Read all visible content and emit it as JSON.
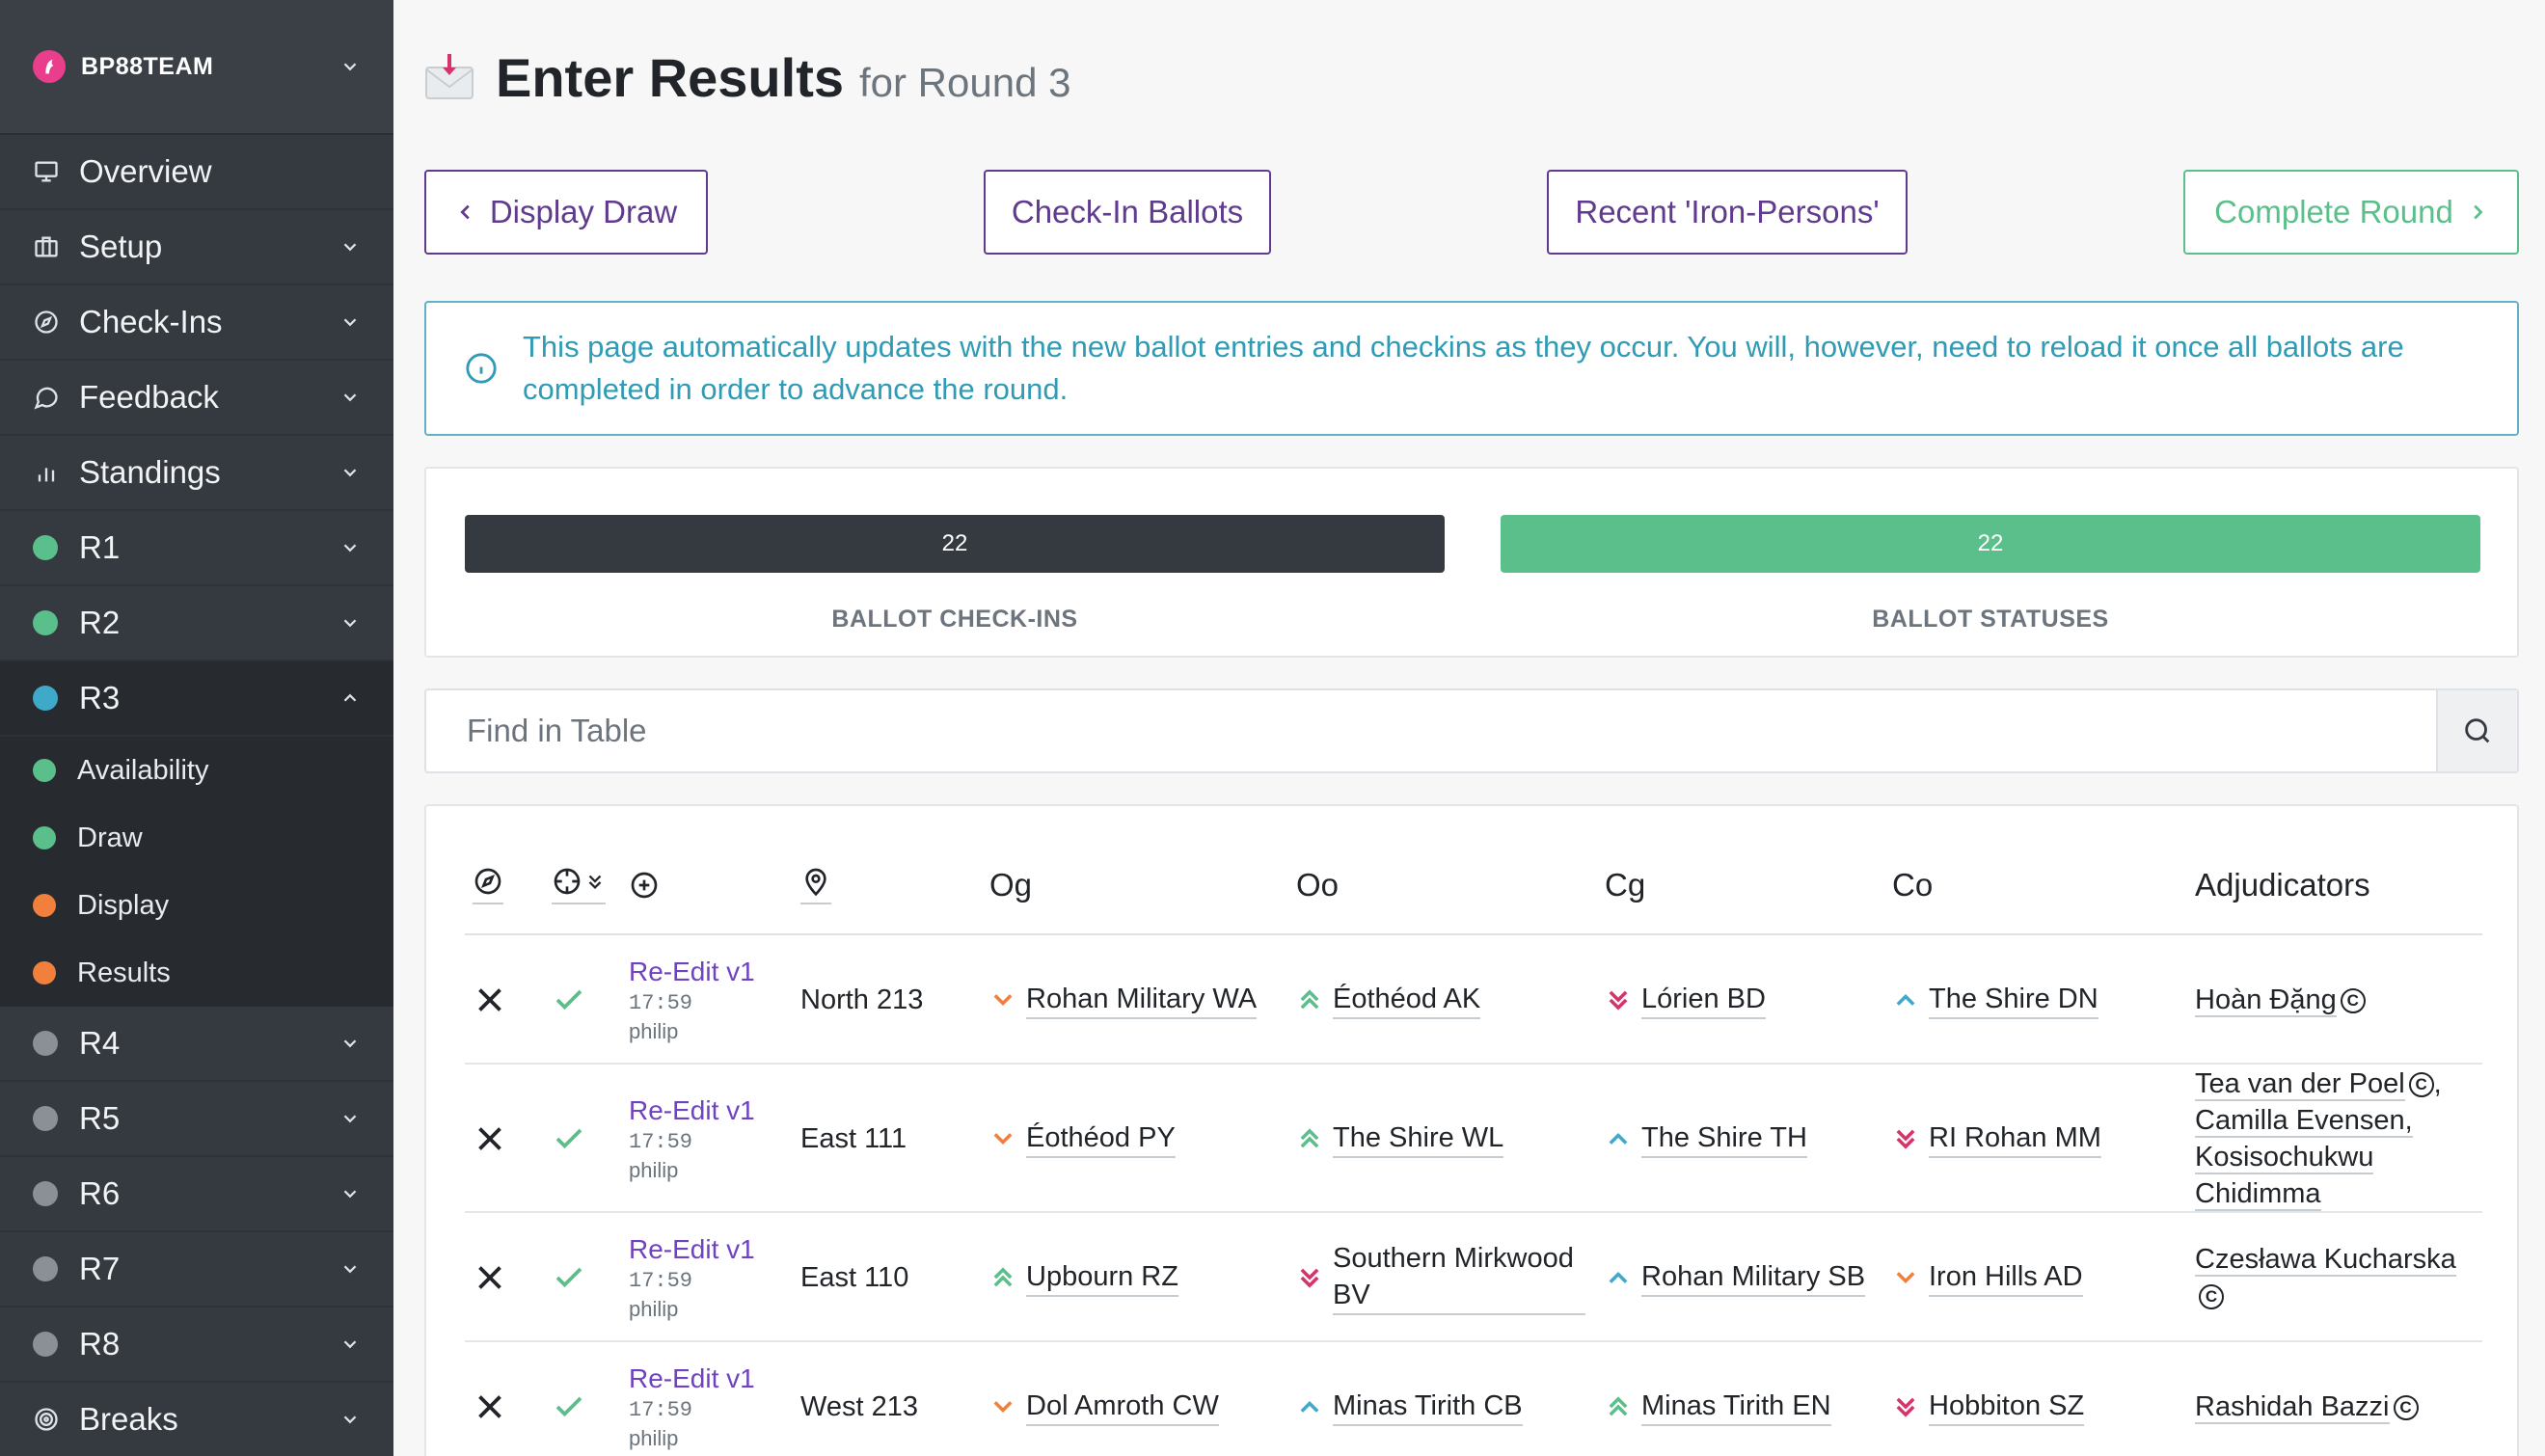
{
  "sidebar": {
    "team": "BP88TEAM",
    "items": [
      {
        "label": "Overview"
      },
      {
        "label": "Setup"
      },
      {
        "label": "Check-Ins"
      },
      {
        "label": "Feedback"
      },
      {
        "label": "Standings"
      },
      {
        "label": "R1"
      },
      {
        "label": "R2"
      },
      {
        "label": "R3"
      },
      {
        "label": "R4"
      },
      {
        "label": "R5"
      },
      {
        "label": "R6"
      },
      {
        "label": "R7"
      },
      {
        "label": "R8"
      },
      {
        "label": "Breaks"
      }
    ],
    "r3_sub": [
      {
        "label": "Availability"
      },
      {
        "label": "Draw"
      },
      {
        "label": "Display"
      },
      {
        "label": "Results"
      }
    ]
  },
  "header": {
    "title": "Enter Results",
    "subtitle": "for Round 3"
  },
  "actions": {
    "display_draw": "Display Draw",
    "check_in_ballots": "Check-In Ballots",
    "recent_iron": "Recent 'Iron-Persons'",
    "complete_round": "Complete Round"
  },
  "alert": {
    "text": "This page automatically updates with the new ballot entries and checkins as they occur. You will, however, need to reload it once all ballots are completed in order to advance the round."
  },
  "stats": {
    "checkins": {
      "count": "22",
      "label": "BALLOT CHECK-INS",
      "color": "#343a40"
    },
    "statuses": {
      "count": "22",
      "label": "BALLOT STATUSES",
      "color": "#5bbf8b"
    }
  },
  "search": {
    "placeholder": "Find in Table"
  },
  "table": {
    "columns": {
      "og": "Og",
      "oo": "Oo",
      "cg": "Cg",
      "co": "Co",
      "adj": "Adjudicators"
    },
    "rows": [
      {
        "version": "Re-Edit v1",
        "time": "17:59",
        "user": "philip",
        "venue": "North 213",
        "og": "Rohan Military WA",
        "oo": "Éothéod AK",
        "cg": "Lórien BD",
        "co": "The Shire DN",
        "adj": [
          "Hoàn Đặng"
        ]
      },
      {
        "version": "Re-Edit v1",
        "time": "17:59",
        "user": "philip",
        "venue": "East 111",
        "og": "Éothéod PY",
        "oo": "The Shire WL",
        "cg": "The Shire TH",
        "co": "RI Rohan MM",
        "adj": [
          "Tea van der Poel",
          "Camilla Evensen,",
          "Kosisochukwu Chidimma"
        ]
      },
      {
        "version": "Re-Edit v1",
        "time": "17:59",
        "user": "philip",
        "venue": "East 110",
        "og": "Upbourn RZ",
        "oo": "Southern Mirkwood BV",
        "cg": "Rohan Military SB",
        "co": "Iron Hills AD",
        "adj": [
          "Czesława Kucharska"
        ]
      },
      {
        "version": "Re-Edit v1",
        "time": "17:59",
        "user": "philip",
        "venue": "West 213",
        "og": "Dol Amroth CW",
        "oo": "Minas Tirith CB",
        "cg": "Minas Tirith EN",
        "co": "Hobbiton SZ",
        "adj": [
          "Rashidah Bazzi"
        ]
      }
    ]
  },
  "colors": {
    "sidebar_bg": "#343a40",
    "accent_purple": "#5f3a8e",
    "success": "#5bbf8b",
    "info": "#2f9bb5",
    "orange": "#f0803c",
    "pink": "#d6336c",
    "teal": "#3fa9c9"
  }
}
